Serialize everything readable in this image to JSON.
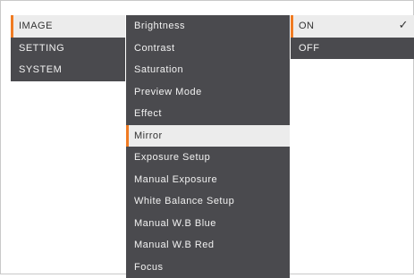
{
  "menu": {
    "level1": [
      {
        "label": "IMAGE"
      },
      {
        "label": "SETTING"
      },
      {
        "label": "SYSTEM"
      }
    ],
    "level2": [
      {
        "label": "Brightness"
      },
      {
        "label": "Contrast"
      },
      {
        "label": "Saturation"
      },
      {
        "label": "Preview Mode"
      },
      {
        "label": "Effect"
      },
      {
        "label": "Mirror"
      },
      {
        "label": "Exposure Setup"
      },
      {
        "label": "Manual Exposure"
      },
      {
        "label": "White Balance Setup"
      },
      {
        "label": "Manual W.B Blue"
      },
      {
        "label": "Manual W.B Red"
      },
      {
        "label": "Focus"
      }
    ],
    "level3": [
      {
        "label": "ON",
        "checked": true,
        "check_icon": "checkmark-icon"
      },
      {
        "label": "OFF",
        "checked": false
      }
    ]
  },
  "colors": {
    "menu_bg": "#4a4a4e",
    "selected_bg": "#ececec",
    "accent": "#f07b22",
    "text_light": "#f2f2f2",
    "text_dark": "#333333"
  }
}
